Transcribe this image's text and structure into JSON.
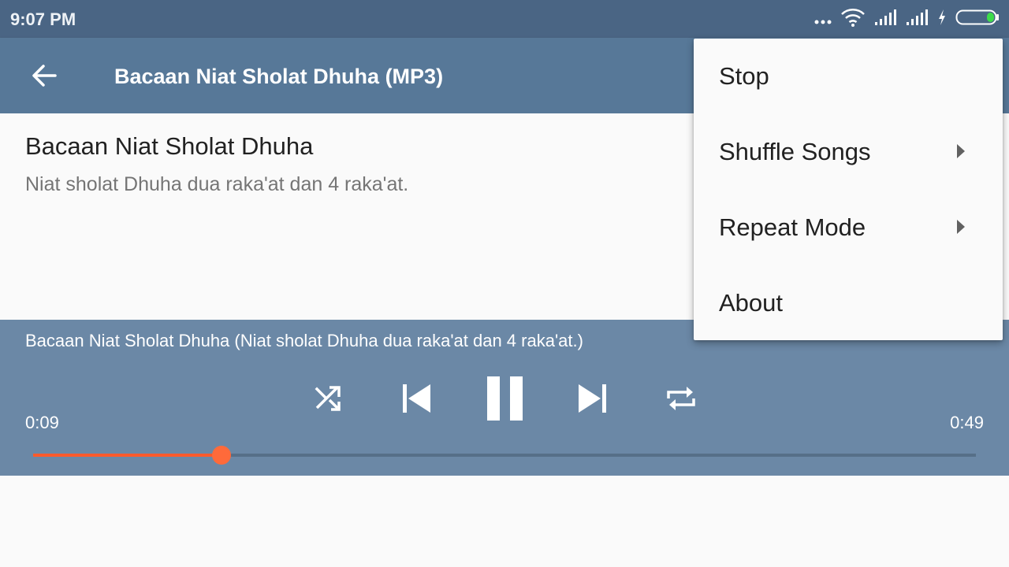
{
  "status_bar": {
    "time": "9:07 PM",
    "icons": [
      "more-dots-icon",
      "wifi-icon",
      "signal-icon",
      "signal-icon",
      "charging-icon",
      "battery-icon"
    ]
  },
  "toolbar": {
    "title": "Bacaan Niat Sholat Dhuha (MP3)",
    "back_icon": "arrow-back-icon"
  },
  "content": {
    "title": "Bacaan Niat Sholat Dhuha",
    "description": "Niat sholat Dhuha dua raka'at dan 4 raka'at."
  },
  "player": {
    "now_playing": "Bacaan Niat Sholat Dhuha (Niat sholat Dhuha dua raka'at dan 4 raka'at.)",
    "current_time": "0:09",
    "total_time": "0:49",
    "progress": 0.2,
    "controls": [
      "shuffle-icon",
      "skip-previous-icon",
      "pause-icon",
      "skip-next-icon",
      "repeat-icon"
    ],
    "accent_color": "#ff5a2c"
  },
  "menu": {
    "items": [
      {
        "label": "Stop",
        "has_submenu": false
      },
      {
        "label": "Shuffle Songs",
        "has_submenu": true
      },
      {
        "label": "Repeat Mode",
        "has_submenu": true
      },
      {
        "label": "About",
        "has_submenu": false
      }
    ]
  },
  "colors": {
    "status_bar": "#4a6584",
    "toolbar": "#577898",
    "player": "#6b88a6"
  }
}
